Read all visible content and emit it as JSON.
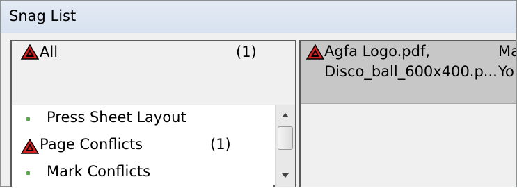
{
  "window": {
    "title": "Snag List"
  },
  "left_panel": {
    "all_row": {
      "icon": "warning-triangle-icon",
      "label": "All",
      "count": "(1)"
    },
    "items": [
      {
        "icon": "green-bullet-icon",
        "label": "Press Sheet Layout",
        "count": ""
      },
      {
        "icon": "warning-triangle-icon",
        "label": "Page Conflicts",
        "count": "(1)"
      },
      {
        "icon": "green-bullet-icon",
        "label": "Mark Conflicts",
        "count": ""
      }
    ],
    "scrollbar": {
      "up": "scroll-up",
      "down": "scroll-down"
    }
  },
  "right_panel": {
    "row": {
      "icon": "warning-triangle-icon",
      "col1_line1": "Agfa Logo.pdf,",
      "col1_line2": "Disco_ball_600x400.p...",
      "col2_line1": "Ma",
      "col2_line2": "Yo"
    }
  },
  "colors": {
    "bullet": "#5aa64a",
    "warning_red": "#d42020"
  }
}
